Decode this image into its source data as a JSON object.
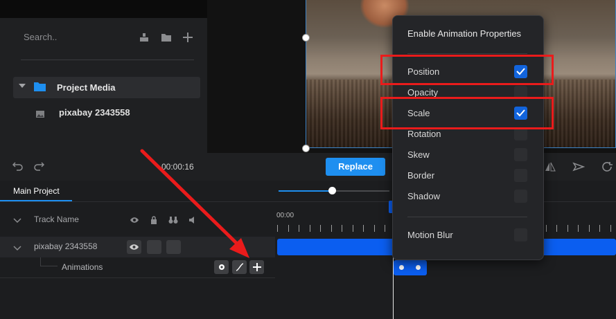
{
  "media_panel": {
    "search_placeholder": "Search..",
    "icons": [
      "import-icon",
      "folder-icon",
      "plus-icon"
    ],
    "project_folder": "Project Media",
    "media_item": "pixabay 2343558"
  },
  "toolbar": {
    "timecode": "00:00:16",
    "replace_label": "Replace"
  },
  "timeline": {
    "tab": "Main Project",
    "ruler_start": "00:00",
    "track_header": "Track Name",
    "track_label": "pixabay 2343558",
    "animations_label": "Animations",
    "accent_color": "#0b5ef0"
  },
  "popup": {
    "title": "Enable Animation Properties",
    "properties": [
      {
        "label": "Position",
        "checked": true
      },
      {
        "label": "Opacity",
        "checked": false
      },
      {
        "label": "Scale",
        "checked": true
      },
      {
        "label": "Rotation",
        "checked": false
      },
      {
        "label": "Skew",
        "checked": false
      },
      {
        "label": "Border",
        "checked": false
      },
      {
        "label": "Shadow",
        "checked": false
      }
    ],
    "extra": {
      "label": "Motion Blur",
      "checked": false
    }
  },
  "annotation_color": "#ea1b1b"
}
